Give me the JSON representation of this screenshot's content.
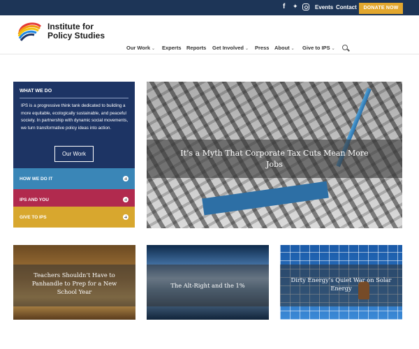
{
  "topbar": {
    "social": [
      "facebook-icon",
      "twitter-icon",
      "instagram-icon"
    ],
    "facebook_glyph": "f",
    "twitter_glyph": "🐦",
    "events": "Events",
    "contact": "Contact",
    "donate": "DONATE NOW"
  },
  "header": {
    "logo_line1": "Institute for",
    "logo_line2": "Policy Studies",
    "nav": [
      {
        "label": "Our Work",
        "dropdown": true
      },
      {
        "label": "Experts",
        "dropdown": false
      },
      {
        "label": "Reports",
        "dropdown": false
      },
      {
        "label": "Get Involved",
        "dropdown": true
      },
      {
        "label": "Press",
        "dropdown": false
      },
      {
        "label": "About",
        "dropdown": true
      },
      {
        "label": "Give to IPS",
        "dropdown": true
      }
    ],
    "chevron": "⌄"
  },
  "panel": {
    "title": "WHAT WE DO",
    "text": "IPS is a progressive think tank dedicated to building a more equitable, ecologically sustainable, and peaceful society. In partnership with dynamic social movements, we turn transformative policy ideas into action.",
    "button": "Our Work",
    "accordion": [
      {
        "label": "HOW WE DO IT",
        "color": "#3a86b7"
      },
      {
        "label": "IPS AND YOU",
        "color": "#b12a4e"
      },
      {
        "label": "GIVE TO IPS",
        "color": "#d8a72e"
      }
    ]
  },
  "hero": {
    "title": "It’s a Myth That Corporate Tax Cuts Mean More Jobs"
  },
  "cards": [
    {
      "title": "Teachers Shouldn’t Have to Panhandle to Prep for a New School Year"
    },
    {
      "title": "The Alt-Right and the 1%"
    },
    {
      "title": "Dirty Energy’s Quiet War on Solar Energy"
    }
  ],
  "colors": {
    "navy": "#1d3464",
    "topbar": "#1d3557",
    "donate": "#e2a72e"
  }
}
